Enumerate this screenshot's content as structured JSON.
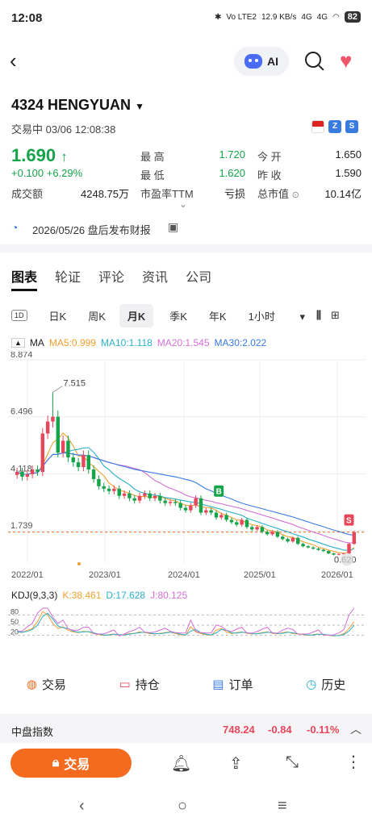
{
  "status": {
    "time": "12:08",
    "net1": "Vo LTE2",
    "speed": "12.9 KB/s",
    "net2": "4G",
    "net3": "4G",
    "battery": "82"
  },
  "nav": {
    "ai_label": "AI"
  },
  "stock": {
    "code_name": "4324 HENGYUAN",
    "status_time": "交易中  03/06 12:08:38",
    "price": "1.690",
    "change": "+0.100 +6.29%",
    "stats": [
      {
        "label": "最  高",
        "value": "1.720",
        "green": true
      },
      {
        "label": "今  开",
        "value": "1.650",
        "green": false
      },
      {
        "label": "最  低",
        "value": "1.620",
        "green": true
      },
      {
        "label": "昨  收",
        "value": "1.590",
        "green": false
      },
      {
        "label": "市盈率TTM",
        "value": "亏损",
        "green": false
      },
      {
        "label": "总市值",
        "value": "10.14亿",
        "green": false
      }
    ],
    "volume_label": "成交额",
    "volume": "4248.75万"
  },
  "report": {
    "text": "2026/05/26 盘后发布财报"
  },
  "tabs": [
    "图表",
    "轮证",
    "评论",
    "资讯",
    "公司"
  ],
  "periods": {
    "tag": "1D",
    "items": [
      "日K",
      "周K",
      "月K",
      "季K",
      "年K"
    ],
    "selected": "月K",
    "interval": "1小时"
  },
  "ma": {
    "label": "MA",
    "ma5": "MA5:0.999",
    "ma10": "MA10:1.118",
    "ma20": "MA20:1.545",
    "ma30": "MA30:2.022"
  },
  "chart_data": {
    "type": "candlestick",
    "y_ticks": [
      "8.874",
      "6.496",
      "4.118",
      "1.739"
    ],
    "x_ticks": [
      "2022/01",
      "2023/01",
      "2024/01",
      "2025/01",
      "2026/01"
    ],
    "high_label": "7.515",
    "low_label": "0.620",
    "current_line": 1.69,
    "ylim": [
      0.4,
      8.874
    ],
    "markers": [
      {
        "label": "B"
      },
      {
        "label": "S"
      }
    ],
    "colors": {
      "up": "#e8475b",
      "down": "#16a34a",
      "ma5": "#f0a030",
      "ma10": "#2bb0c8",
      "ma20": "#d36fd6",
      "ma30": "#3a7be0"
    }
  },
  "kdj": {
    "label": "KDJ(9,3,3)",
    "k": "K:38.461",
    "d": "D:17.628",
    "j": "J:80.125",
    "levels": [
      "80",
      "50",
      "20"
    ]
  },
  "actions": [
    "交易",
    "持仓",
    "订单",
    "历史"
  ],
  "index": {
    "name": "中盘指数",
    "value": "748.24",
    "change": "-0.84",
    "pct": "-0.11%"
  },
  "bottom": {
    "trade": "交易"
  }
}
